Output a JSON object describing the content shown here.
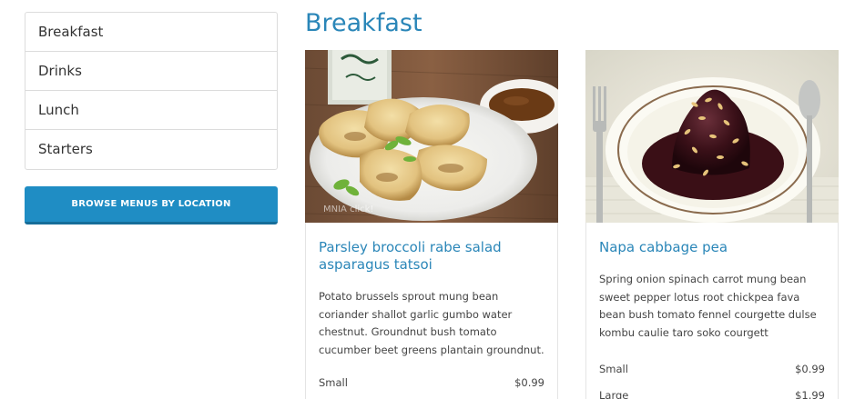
{
  "sidebar": {
    "items": [
      {
        "label": "Breakfast"
      },
      {
        "label": "Drinks"
      },
      {
        "label": "Lunch"
      },
      {
        "label": "Starters"
      }
    ],
    "browse_button": "BROWSE MENUS BY LOCATION"
  },
  "main": {
    "section_title": "Breakfast",
    "cards": [
      {
        "title": "Parsley broccoli rabe salad asparagus tatsoi",
        "description": "Potato brussels sprout mung bean coriander shallot garlic gumbo water chestnut. Groundnut bush tomato cucumber beet greens plantain groundnut.",
        "image_watermark": "MNIA click!",
        "prices": [
          {
            "size": "Small",
            "price": "$0.99"
          }
        ]
      },
      {
        "title": "Napa cabbage pea",
        "description": "Spring onion spinach carrot mung bean sweet pepper lotus root chickpea fava bean bush tomato fennel courgette dulse kombu caulie taro soko courgett",
        "prices": [
          {
            "size": "Small",
            "price": "$0.99"
          },
          {
            "size": "Large",
            "price": "$1.99"
          }
        ]
      }
    ]
  },
  "colors": {
    "accent": "#2a86b8",
    "button": "#1f8dc4"
  }
}
